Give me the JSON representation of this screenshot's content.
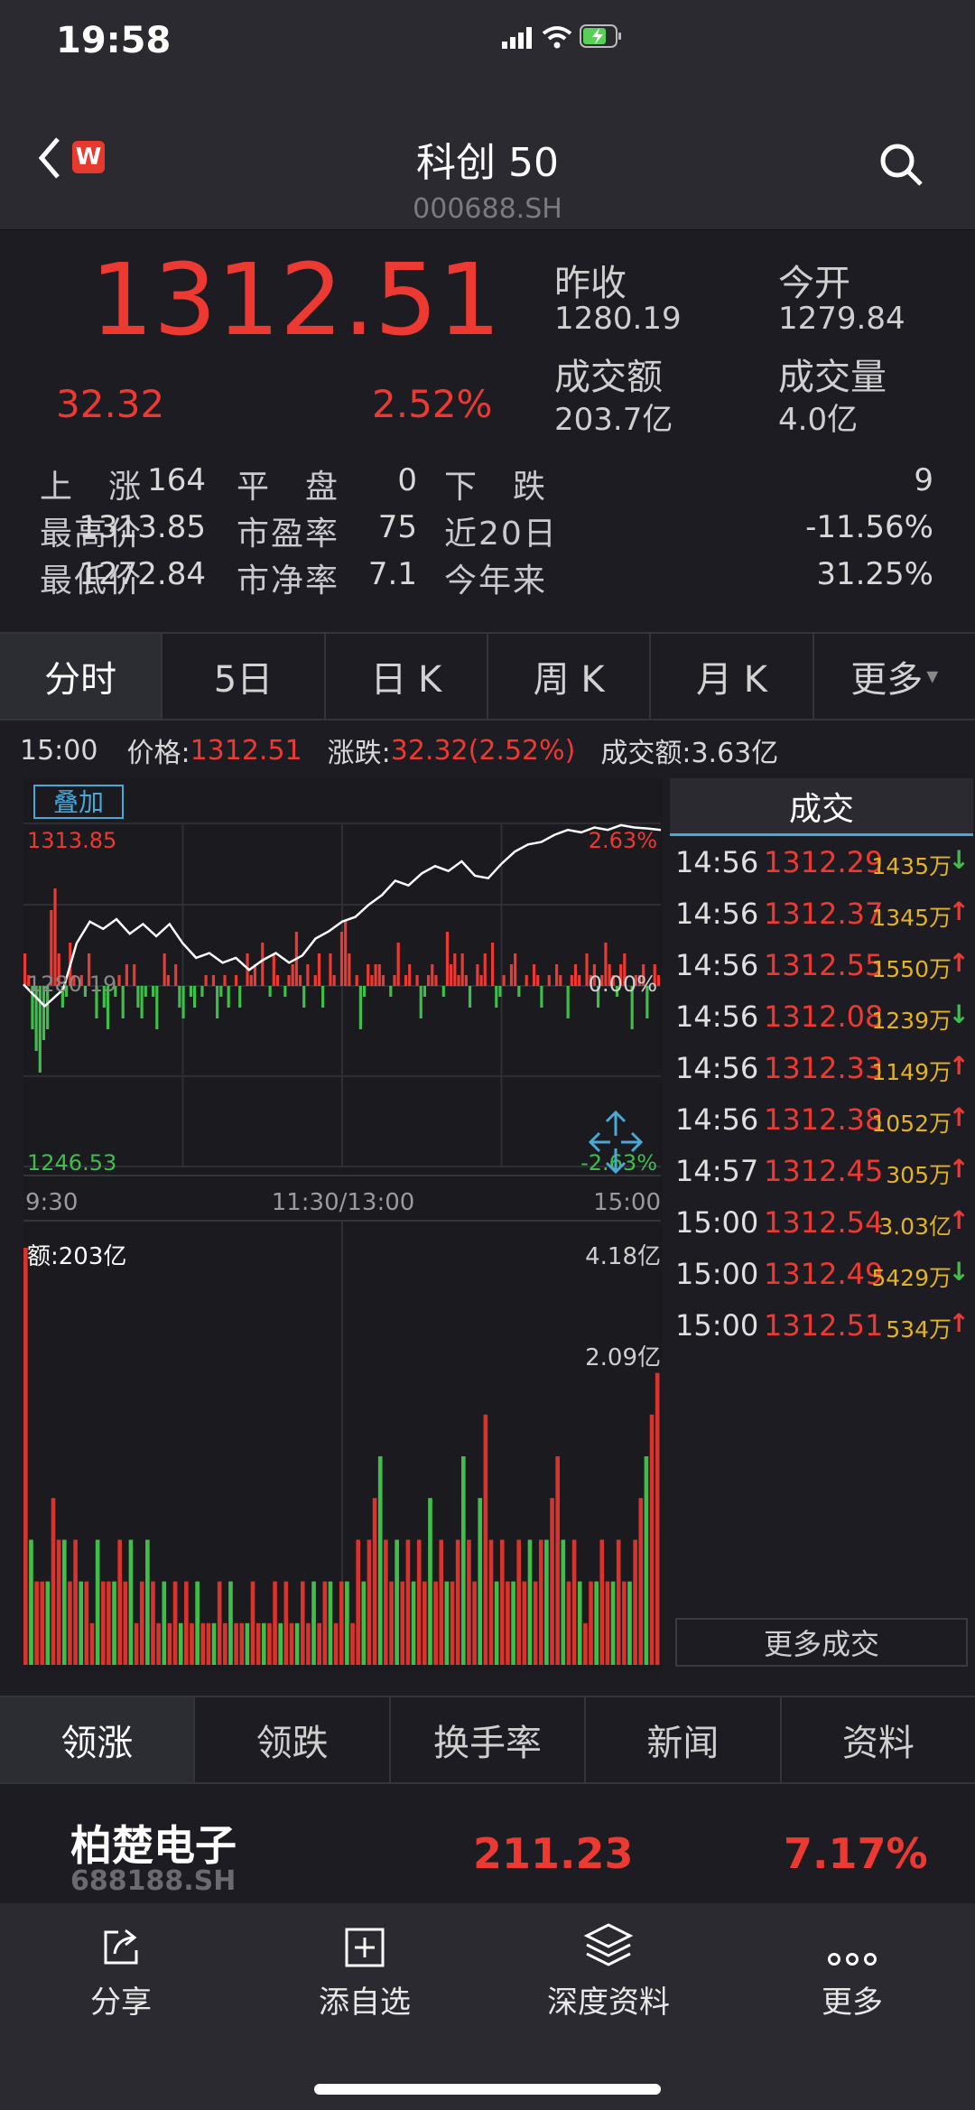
{
  "status": {
    "time": "19:58"
  },
  "nav": {
    "title": "科创 50",
    "code": "000688.SH",
    "app_badge": "W"
  },
  "quote": {
    "price": "1312.51",
    "change": "32.32",
    "change_pct": "2.52%",
    "prev_close_label": "昨收",
    "prev_close": "1280.19",
    "open_label": "今开",
    "open": "1279.84",
    "turnover_label": "成交额",
    "turnover": "203.7亿",
    "volume_label": "成交量",
    "volume": "4.0亿",
    "stats": [
      [
        {
          "label": "上　涨",
          "value": "164"
        },
        {
          "label": "平　盘",
          "value": "0"
        },
        {
          "label": "下　跌",
          "value": "9"
        }
      ],
      [
        {
          "label": "最高价",
          "value": "1313.85"
        },
        {
          "label": "市盈率",
          "value": "75"
        },
        {
          "label": "近20日",
          "value": "-11.56%"
        }
      ],
      [
        {
          "label": "最低价",
          "value": "1272.84"
        },
        {
          "label": "市净率",
          "value": "7.1"
        },
        {
          "label": "今年来",
          "value": "31.25%"
        }
      ]
    ]
  },
  "period_tabs": [
    "分时",
    "5日",
    "日 K",
    "周 K",
    "月 K",
    "更多"
  ],
  "info": {
    "time": "15:00",
    "price_label": "价格:",
    "price": "1312.51",
    "change_label": "涨跌:",
    "change": "32.32(2.52%)",
    "amount_label": "成交额:",
    "amount": "3.63亿"
  },
  "chart": {
    "overlay_label": "叠加",
    "y_high": "1313.85",
    "y_mid": "1280.19",
    "y_low": "1246.53",
    "pct_high": "2.63%",
    "pct_mid": "0.00%",
    "pct_low": "-2.63%",
    "x_start": "9:30",
    "x_mid": "11:30/13:00",
    "x_end": "15:00",
    "vol_label": "额:203亿",
    "vol_high": "4.18亿",
    "vol_mid": "2.09亿"
  },
  "chart_data": {
    "type": "line",
    "ylim": [
      1246.53,
      1313.85
    ],
    "prev_close": 1280.19,
    "price_x": [
      0,
      8,
      15,
      20,
      25,
      30,
      35,
      40,
      45,
      50,
      55,
      60,
      65,
      70,
      75,
      80,
      85,
      90,
      95,
      100,
      105,
      110,
      115,
      120,
      125,
      130,
      135,
      140,
      145,
      150,
      155,
      160,
      165,
      170,
      175,
      180,
      185,
      190,
      195,
      200,
      205,
      210,
      215,
      220,
      225,
      230,
      235,
      240
    ],
    "price_y": [
      1280.5,
      1276.0,
      1279.5,
      1289.0,
      1293.5,
      1292.0,
      1294.0,
      1291.0,
      1293.0,
      1290.5,
      1293.0,
      1289.0,
      1286.0,
      1287.0,
      1285.0,
      1286.0,
      1283.5,
      1285.5,
      1287.0,
      1285.0,
      1286.5,
      1290.0,
      1291.5,
      1293.5,
      1294.5,
      1297.0,
      1299.0,
      1302.0,
      1301.0,
      1303.5,
      1305.0,
      1304.0,
      1306.0,
      1303.0,
      1302.5,
      1305.5,
      1308.0,
      1309.5,
      1310.0,
      1311.5,
      1312.5,
      1312.0,
      1313.0,
      1312.5,
      1313.5,
      1313.0,
      1312.8,
      1312.51
    ],
    "breadth": [
      3,
      1,
      -4,
      -6,
      -8,
      -5,
      -4,
      7,
      9,
      3,
      -2,
      -1,
      4,
      1,
      0,
      1,
      -1,
      3,
      0,
      -3,
      0,
      -2,
      -4,
      0,
      -1,
      1,
      -3,
      2,
      0,
      2,
      -2,
      -3,
      -1,
      0,
      -1,
      -4,
      0,
      3,
      1,
      0,
      2,
      -2,
      -3,
      0,
      -1,
      -2,
      0,
      -1,
      1,
      0,
      1,
      -3,
      -1,
      1,
      -2,
      0,
      1,
      -2,
      0,
      3,
      1,
      2,
      0,
      4,
      0,
      -1,
      3,
      1,
      0,
      -1,
      1,
      2,
      5,
      1,
      -2,
      2,
      0,
      1,
      3,
      -2,
      0,
      3,
      1,
      0,
      5,
      6,
      3,
      0,
      1,
      -4,
      -1,
      2,
      1,
      2,
      2,
      1,
      0,
      -1,
      1,
      4,
      0,
      1,
      2,
      0,
      1,
      -3,
      -1,
      1,
      2,
      1,
      0,
      -1,
      5,
      2,
      3,
      1,
      3,
      1,
      -2,
      0,
      2,
      1,
      3,
      0,
      4,
      -2,
      -1,
      1,
      0,
      2,
      3,
      -1,
      0,
      1,
      0,
      2,
      1,
      -2,
      0,
      1,
      0,
      2,
      1,
      0,
      -3,
      1,
      2,
      1,
      0,
      3,
      1,
      2,
      -2,
      1,
      4,
      2,
      1,
      -1,
      2,
      3,
      0,
      -4,
      1,
      1,
      2,
      -3,
      0,
      2,
      1
    ],
    "volume": [
      10,
      3,
      2,
      2,
      2,
      4,
      3,
      3,
      2,
      3,
      2,
      2,
      1,
      3,
      2,
      2,
      2,
      3,
      2,
      3,
      1,
      2,
      3,
      2,
      1,
      2,
      1,
      2,
      1,
      2,
      1,
      2,
      1,
      1,
      1,
      2,
      1,
      2,
      1,
      1,
      1,
      2,
      1,
      1,
      1,
      2,
      1,
      2,
      1,
      1,
      2,
      1,
      2,
      1,
      2,
      2,
      1,
      2,
      2,
      1,
      3,
      2,
      3,
      4,
      5,
      3,
      2,
      3,
      2,
      3,
      2,
      3,
      2,
      4,
      2,
      3,
      2,
      2,
      3,
      5,
      3,
      2,
      4,
      6,
      3,
      2,
      3,
      2,
      2,
      3,
      2,
      3,
      2,
      3,
      3,
      4,
      5,
      3,
      2,
      3,
      2,
      1,
      2,
      2,
      3,
      2,
      2,
      3,
      2,
      2,
      3,
      4,
      5,
      6,
      7
    ]
  },
  "trades": {
    "header": "成交",
    "rows": [
      {
        "time": "14:56",
        "price": "1312.29",
        "vol": "1435万",
        "dir": "down"
      },
      {
        "time": "14:56",
        "price": "1312.37",
        "vol": "1345万",
        "dir": "up"
      },
      {
        "time": "14:56",
        "price": "1312.55",
        "vol": "1550万",
        "dir": "up"
      },
      {
        "time": "14:56",
        "price": "1312.08",
        "vol": "1239万",
        "dir": "down"
      },
      {
        "time": "14:56",
        "price": "1312.33",
        "vol": "1149万",
        "dir": "up"
      },
      {
        "time": "14:56",
        "price": "1312.38",
        "vol": "1052万",
        "dir": "up"
      },
      {
        "time": "14:57",
        "price": "1312.45",
        "vol": "305万",
        "dir": "up"
      },
      {
        "time": "15:00",
        "price": "1312.54",
        "vol": "3.03亿",
        "dir": "up"
      },
      {
        "time": "15:00",
        "price": "1312.49",
        "vol": "5429万",
        "dir": "down"
      },
      {
        "time": "15:00",
        "price": "1312.51",
        "vol": "534万",
        "dir": "up"
      }
    ],
    "more": "更多成交"
  },
  "bottom_tabs": [
    "领涨",
    "领跌",
    "换手率",
    "新闻",
    "资料"
  ],
  "stock": {
    "name": "柏楚电子",
    "code": "688188.SH",
    "price": "211.23",
    "pct": "7.17%"
  },
  "toolbar": {
    "share": "分享",
    "add": "添自选",
    "deep": "深度资料",
    "more": "更多"
  },
  "colors": {
    "up": "#ec3a33",
    "down": "#3fbf4a",
    "accent": "#4aa8d8",
    "gold": "#e2b227"
  }
}
